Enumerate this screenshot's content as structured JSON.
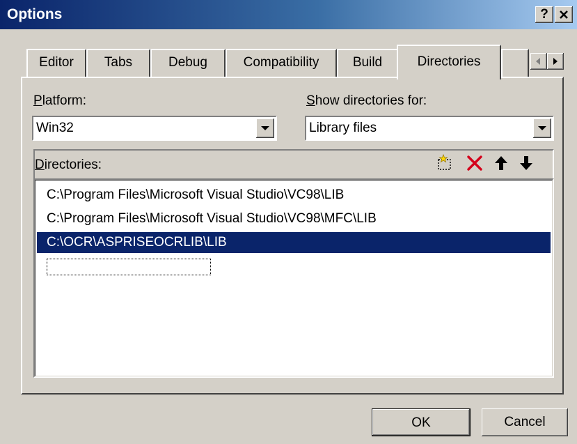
{
  "window": {
    "title": "Options",
    "help_label": "?",
    "close_label": "X"
  },
  "tabs": [
    {
      "label": "Editor"
    },
    {
      "label": "Tabs"
    },
    {
      "label": "Debug"
    },
    {
      "label": "Compatibility"
    },
    {
      "label": "Build"
    },
    {
      "label": "Directories",
      "active": true
    }
  ],
  "tab_scroll": {
    "left_icon": "triangle-left-icon",
    "right_icon": "triangle-right-icon"
  },
  "platform": {
    "label_mnemonic": "P",
    "label_rest": "latform:",
    "value": "Win32"
  },
  "show_for": {
    "label_mnemonic": "S",
    "label_rest": "how directories for:",
    "value": "Library files"
  },
  "directories": {
    "label_mnemonic": "D",
    "label_rest": "irectories:",
    "toolbar_icons": [
      "new-folder-icon",
      "delete-x-icon",
      "move-up-arrow-icon",
      "move-down-arrow-icon"
    ],
    "items": [
      "C:\\Program Files\\Microsoft Visual Studio\\VC98\\LIB",
      "C:\\Program Files\\Microsoft Visual Studio\\VC98\\MFC\\LIB",
      "C:\\OCR\\ASPRISEOCRLIB\\LIB"
    ],
    "selected_index": 2
  },
  "buttons": {
    "ok": "OK",
    "cancel": "Cancel"
  },
  "colors": {
    "selection": "#0a246a",
    "titlebar_start": "#0a246a",
    "delete_icon": "#d4001a"
  }
}
